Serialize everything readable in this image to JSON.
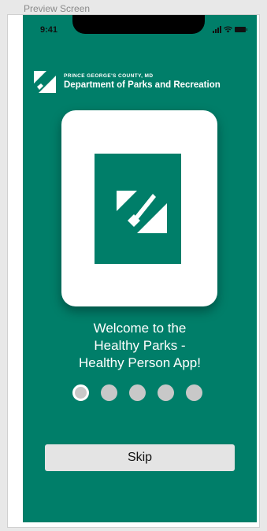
{
  "preview": {
    "label": "Preview Screen"
  },
  "status_bar": {
    "time": "9:41",
    "icons": [
      "signal-icon",
      "wifi-icon",
      "battery-icon"
    ]
  },
  "header": {
    "county": "PRINCE GEORGE'S COUNTY, MD",
    "department": "Department of Parks and Recreation",
    "logo_icon": "parks-logo-icon"
  },
  "card": {
    "logo_icon": "parks-logo-icon"
  },
  "welcome": {
    "text": "Welcome to the\nHealthy Parks -\nHealthy Person App!"
  },
  "pagination": {
    "total": 5,
    "active_index": 0
  },
  "skip": {
    "label": "Skip"
  },
  "colors": {
    "brand_green": "#007e69",
    "white": "#ffffff",
    "dot_gray": "#c8c8c8",
    "button_gray": "#e4e4e4"
  }
}
